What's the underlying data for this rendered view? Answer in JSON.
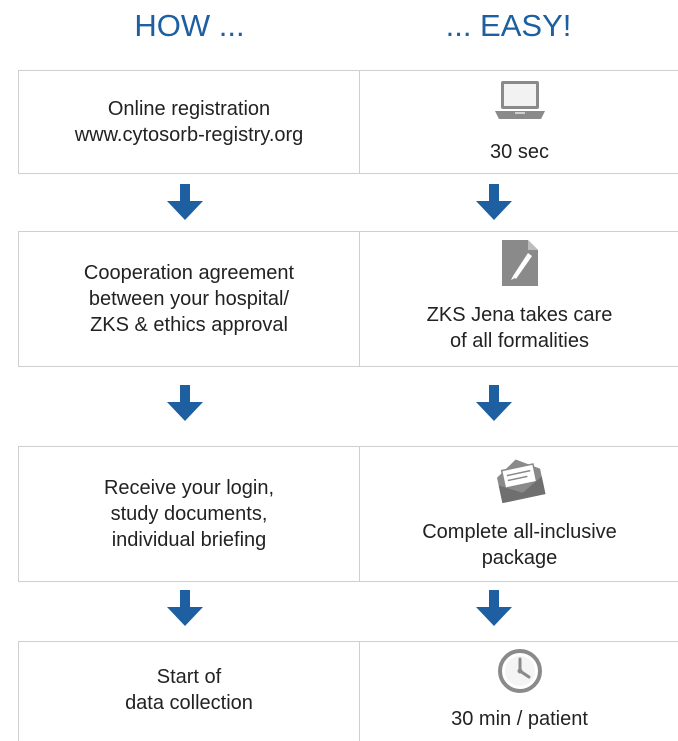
{
  "headings": {
    "how": "HOW ...",
    "easy": "... EASY!"
  },
  "steps": [
    {
      "left_lines": [
        "Online registration",
        "www.cytosorb-registry.org"
      ],
      "right_icon": "laptop-icon",
      "right_lines": [
        "30 sec"
      ]
    },
    {
      "left_lines": [
        "Cooperation agreement",
        "between your hospital/",
        "ZKS & ethics approval"
      ],
      "right_icon": "document-pen-icon",
      "right_lines": [
        "ZKS Jena takes care",
        "of all formalities"
      ]
    },
    {
      "left_lines": [
        "Receive your login,",
        "study documents,",
        "individual briefing"
      ],
      "right_icon": "envelope-icon",
      "right_lines": [
        "Complete all-inclusive",
        "package"
      ]
    },
    {
      "left_lines": [
        "Start of",
        "data collection"
      ],
      "right_icon": "clock-icon",
      "right_lines": [
        "30 min / patient"
      ]
    }
  ],
  "colors": {
    "accent": "#1d5fa0",
    "icon_gray": "#8a8a8a",
    "border": "#cfcfcf"
  }
}
